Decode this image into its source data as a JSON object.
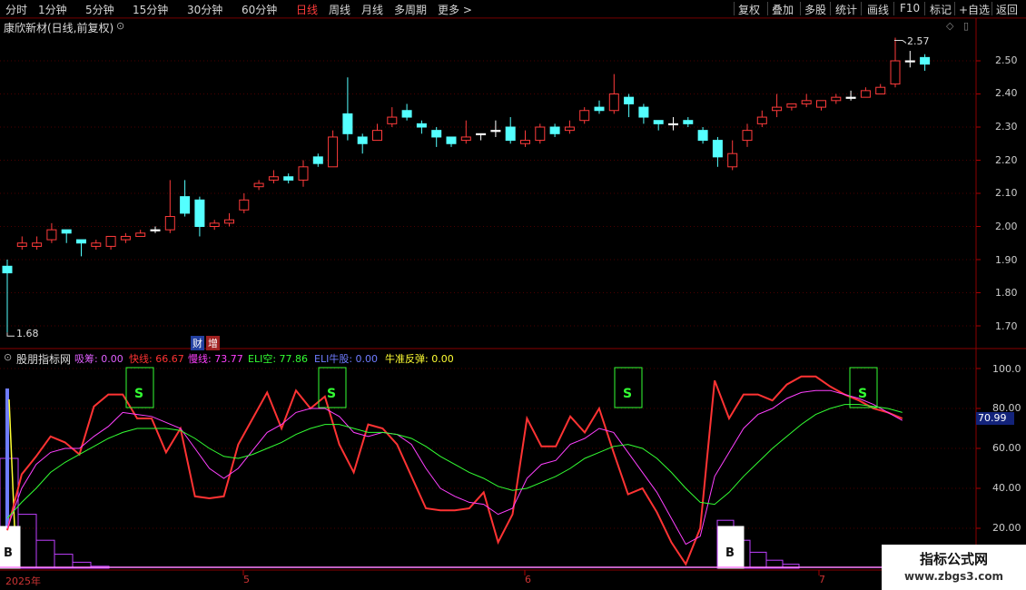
{
  "toolbar": {
    "periods": [
      "分时",
      "1分钟",
      "5分钟",
      "15分钟",
      "30分钟",
      "60分钟",
      "日线",
      "周线",
      "月线",
      "多周期",
      "更多 >"
    ],
    "active_period": "日线",
    "actions": [
      "复权",
      "叠加",
      "多股",
      "统计",
      "画线",
      "F10",
      "标记",
      "+自选",
      "返回"
    ]
  },
  "stock": {
    "title": "康欣新材(日线,前复权)",
    "high_label": "2.57",
    "low_label": "1.68",
    "marks": [
      "财",
      "增"
    ],
    "price_axis": [
      "2.50",
      "2.40",
      "2.30",
      "2.20",
      "2.10",
      "2.00",
      "1.90",
      "1.80",
      "1.70"
    ]
  },
  "indicator": {
    "name": "股朋指标网",
    "params": [
      {
        "label": "吸筹: 0.00",
        "color": "#e060ff"
      },
      {
        "label": "快线: 66.67",
        "color": "#ff3333"
      },
      {
        "label": "慢线: 73.77",
        "color": "#ff40ff"
      },
      {
        "label": "ELI空: 77.86",
        "color": "#33ff33"
      },
      {
        "label": "ELI牛股: 0.00",
        "color": "#6f7cff"
      },
      {
        "label": "牛准反弹: 0.00",
        "color": "#ffff33"
      }
    ],
    "axis": [
      "100.0",
      "80.00",
      "60.00",
      "40.00",
      "20.00"
    ],
    "current_value": "70.99",
    "signal_b": "B",
    "signal_s": "S"
  },
  "dates": [
    "2025年",
    "5",
    "6",
    "7"
  ],
  "watermark": {
    "line1": "指标公式网",
    "line2": "www.zbgs3.com"
  },
  "chart_data": {
    "type": "candlestick",
    "title": "康欣新材(日线,前复权)",
    "ylim": [
      1.65,
      2.62
    ],
    "candles": [
      [
        1.88,
        1.86,
        1.9,
        1.68
      ],
      [
        1.94,
        1.95,
        1.97,
        1.93
      ],
      [
        1.94,
        1.95,
        1.97,
        1.93
      ],
      [
        1.96,
        1.99,
        2.01,
        1.95
      ],
      [
        1.99,
        1.98,
        1.99,
        1.95
      ],
      [
        1.96,
        1.95,
        1.96,
        1.91
      ],
      [
        1.94,
        1.95,
        1.96,
        1.93
      ],
      [
        1.94,
        1.97,
        1.97,
        1.93
      ],
      [
        1.96,
        1.97,
        1.98,
        1.95
      ],
      [
        1.97,
        1.98,
        1.99,
        1.97
      ],
      [
        1.99,
        1.99,
        2.0,
        1.98
      ],
      [
        1.99,
        2.03,
        2.14,
        1.98
      ],
      [
        2.09,
        2.04,
        2.14,
        2.03
      ],
      [
        2.08,
        2.0,
        2.09,
        1.97
      ],
      [
        2.0,
        2.01,
        2.02,
        1.99
      ],
      [
        2.01,
        2.02,
        2.04,
        2.0
      ],
      [
        2.05,
        2.08,
        2.1,
        2.04
      ],
      [
        2.12,
        2.13,
        2.14,
        2.11
      ],
      [
        2.14,
        2.15,
        2.17,
        2.13
      ],
      [
        2.15,
        2.14,
        2.16,
        2.13
      ],
      [
        2.14,
        2.18,
        2.2,
        2.12
      ],
      [
        2.21,
        2.19,
        2.22,
        2.18
      ],
      [
        2.18,
        2.27,
        2.29,
        2.18
      ],
      [
        2.34,
        2.28,
        2.45,
        2.26
      ],
      [
        2.27,
        2.25,
        2.28,
        2.22
      ],
      [
        2.26,
        2.29,
        2.31,
        2.26
      ],
      [
        2.31,
        2.33,
        2.36,
        2.3
      ],
      [
        2.35,
        2.33,
        2.37,
        2.32
      ],
      [
        2.31,
        2.3,
        2.32,
        2.28
      ],
      [
        2.29,
        2.27,
        2.3,
        2.24
      ],
      [
        2.27,
        2.25,
        2.27,
        2.24
      ],
      [
        2.26,
        2.27,
        2.32,
        2.25
      ],
      [
        2.28,
        2.28,
        2.28,
        2.26
      ],
      [
        2.29,
        2.29,
        2.32,
        2.27
      ],
      [
        2.3,
        2.26,
        2.33,
        2.25
      ],
      [
        2.25,
        2.26,
        2.29,
        2.24
      ],
      [
        2.26,
        2.3,
        2.31,
        2.25
      ],
      [
        2.3,
        2.28,
        2.31,
        2.27
      ],
      [
        2.29,
        2.3,
        2.32,
        2.28
      ],
      [
        2.32,
        2.35,
        2.36,
        2.31
      ],
      [
        2.36,
        2.35,
        2.38,
        2.34
      ],
      [
        2.35,
        2.4,
        2.46,
        2.34
      ],
      [
        2.39,
        2.37,
        2.4,
        2.33
      ],
      [
        2.36,
        2.33,
        2.37,
        2.31
      ],
      [
        2.32,
        2.31,
        2.32,
        2.29
      ],
      [
        2.31,
        2.31,
        2.33,
        2.29
      ],
      [
        2.32,
        2.31,
        2.33,
        2.3
      ],
      [
        2.29,
        2.26,
        2.3,
        2.25
      ],
      [
        2.26,
        2.21,
        2.27,
        2.18
      ],
      [
        2.18,
        2.22,
        2.26,
        2.17
      ],
      [
        2.26,
        2.29,
        2.31,
        2.24
      ],
      [
        2.31,
        2.33,
        2.35,
        2.3
      ],
      [
        2.35,
        2.36,
        2.4,
        2.33
      ],
      [
        2.36,
        2.37,
        2.37,
        2.35
      ],
      [
        2.37,
        2.38,
        2.4,
        2.36
      ],
      [
        2.36,
        2.38,
        2.38,
        2.35
      ],
      [
        2.38,
        2.39,
        2.4,
        2.37
      ],
      [
        2.39,
        2.39,
        2.41,
        2.38
      ],
      [
        2.39,
        2.41,
        2.42,
        2.39
      ],
      [
        2.4,
        2.42,
        2.43,
        2.4
      ],
      [
        2.43,
        2.5,
        2.57,
        2.42
      ],
      [
        2.5,
        2.5,
        2.53,
        2.48
      ],
      [
        2.51,
        2.49,
        2.52,
        2.47
      ]
    ],
    "indicator_ylim": [
      0,
      105
    ],
    "series": [
      {
        "name": "快线",
        "color": "#ff3333",
        "values": [
          19,
          47,
          56,
          66,
          63,
          57,
          81,
          87,
          87,
          75,
          75,
          58,
          70,
          36,
          35,
          36,
          62,
          75,
          88,
          70,
          89,
          80,
          86,
          62,
          48,
          72,
          70,
          62,
          46,
          30,
          29,
          29,
          30,
          38,
          13,
          27,
          75,
          61,
          61,
          76,
          68,
          80,
          58,
          37,
          40,
          28,
          13,
          2,
          20,
          94,
          75,
          87,
          87,
          84,
          92,
          96,
          96,
          91,
          87,
          84,
          80,
          78,
          75
        ]
      },
      {
        "name": "慢线",
        "color": "#ff40ff",
        "values": [
          20,
          40,
          52,
          58,
          60,
          60,
          66,
          71,
          78,
          77,
          76,
          73,
          70,
          60,
          50,
          45,
          50,
          59,
          68,
          72,
          78,
          80,
          80,
          76,
          68,
          66,
          68,
          67,
          62,
          50,
          40,
          36,
          33,
          32,
          27,
          30,
          45,
          52,
          54,
          62,
          65,
          70,
          68,
          58,
          48,
          38,
          25,
          12,
          16,
          46,
          58,
          70,
          77,
          80,
          85,
          88,
          89,
          89,
          87,
          85,
          82,
          78,
          74
        ]
      },
      {
        "name": "ELI空",
        "color": "#33ff33",
        "values": [
          25,
          33,
          40,
          48,
          53,
          57,
          61,
          65,
          68,
          70,
          70,
          70,
          69,
          65,
          60,
          56,
          55,
          57,
          60,
          63,
          67,
          70,
          72,
          72,
          70,
          68,
          68,
          67,
          65,
          61,
          56,
          52,
          48,
          45,
          41,
          39,
          40,
          43,
          46,
          50,
          55,
          58,
          61,
          62,
          60,
          55,
          48,
          40,
          33,
          32,
          38,
          46,
          53,
          60,
          66,
          72,
          77,
          80,
          82,
          82,
          81,
          80,
          78
        ]
      }
    ],
    "xlabels": [
      "2025年",
      "5",
      "6",
      "7"
    ]
  }
}
